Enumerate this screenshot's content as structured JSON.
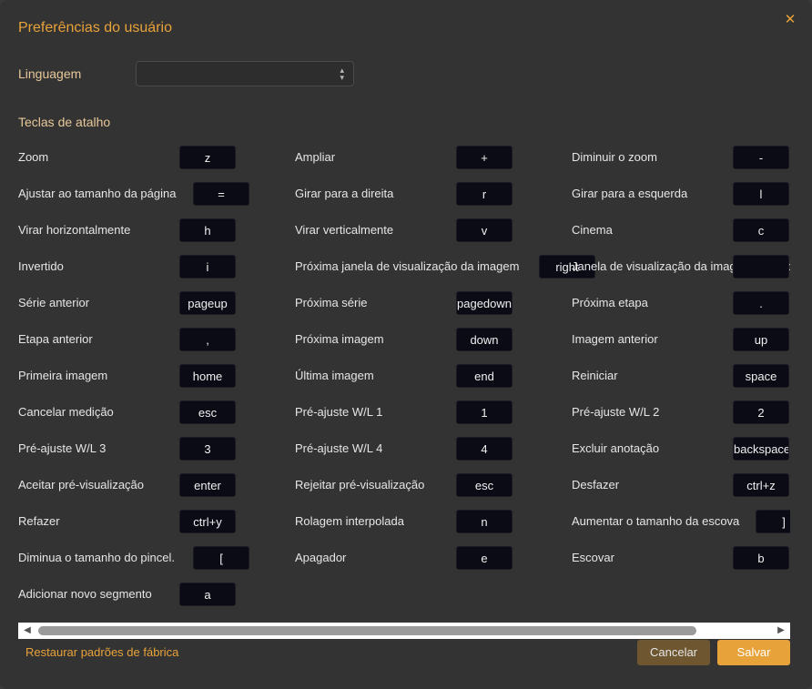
{
  "dialog": {
    "title": "Preferências do usuário",
    "close_icon": "close-icon",
    "language_label": "Linguagem",
    "language_value": "",
    "shortcuts_title": "Teclas de atalho"
  },
  "shortcuts": [
    [
      {
        "label": "Zoom",
        "key": "z"
      },
      {
        "label": "Ampliar",
        "key": "+"
      },
      {
        "label": "Diminuir o zoom",
        "key": "-"
      }
    ],
    [
      {
        "label": "Ajustar ao tamanho da página",
        "key": "="
      },
      {
        "label": "Girar para a direita",
        "key": "r"
      },
      {
        "label": "Girar para a esquerda",
        "key": "l"
      }
    ],
    [
      {
        "label": "Virar horizontalmente",
        "key": "h"
      },
      {
        "label": "Virar verticalmente",
        "key": "v"
      },
      {
        "label": "Cinema",
        "key": "c"
      }
    ],
    [
      {
        "label": "Invertido",
        "key": "i"
      },
      {
        "label": "Próxima janela de visualização da imagem",
        "key": "right"
      },
      {
        "label": "Janela de visualização da imagem anterior",
        "key": ""
      }
    ],
    [
      {
        "label": "Série anterior",
        "key": "pageup"
      },
      {
        "label": "Próxima série",
        "key": "pagedown"
      },
      {
        "label": "Próxima etapa",
        "key": "."
      }
    ],
    [
      {
        "label": "Etapa anterior",
        "key": ","
      },
      {
        "label": "Próxima imagem",
        "key": "down"
      },
      {
        "label": "Imagem anterior",
        "key": "up"
      }
    ],
    [
      {
        "label": "Primeira imagem",
        "key": "home"
      },
      {
        "label": "Última imagem",
        "key": "end"
      },
      {
        "label": "Reiniciar",
        "key": "space"
      }
    ],
    [
      {
        "label": "Cancelar medição",
        "key": "esc"
      },
      {
        "label": "Pré-ajuste W/L 1",
        "key": "1"
      },
      {
        "label": "Pré-ajuste W/L 2",
        "key": "2"
      }
    ],
    [
      {
        "label": "Pré-ajuste W/L 3",
        "key": "3"
      },
      {
        "label": "Pré-ajuste W/L 4",
        "key": "4"
      },
      {
        "label": "Excluir anotação",
        "key": "backspace"
      }
    ],
    [
      {
        "label": "Aceitar pré-visualização",
        "key": "enter"
      },
      {
        "label": "Rejeitar pré-visualização",
        "key": "esc"
      },
      {
        "label": "Desfazer",
        "key": "ctrl+z"
      }
    ],
    [
      {
        "label": "Refazer",
        "key": "ctrl+y"
      },
      {
        "label": "Rolagem interpolada",
        "key": "n"
      },
      {
        "label": "Aumentar o tamanho da escova",
        "key": "]"
      }
    ],
    [
      {
        "label": "Diminua o tamanho do pincel.",
        "key": "["
      },
      {
        "label": "Apagador",
        "key": "e"
      },
      {
        "label": "Escovar",
        "key": "b"
      }
    ],
    [
      {
        "label": "Adicionar novo segmento",
        "key": "a"
      }
    ]
  ],
  "footer": {
    "restore_label": "Restaurar padrões de fábrica",
    "cancel_label": "Cancelar",
    "save_label": "Salvar"
  },
  "colors": {
    "accent": "#e8a23a",
    "background": "#333333",
    "key_background": "#0b0b16"
  }
}
